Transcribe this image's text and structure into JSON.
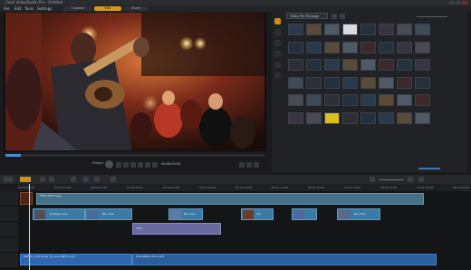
{
  "app": {
    "title": "Corel VideoStudio Pro - Untitled"
  },
  "menu": {
    "file": "File",
    "edit": "Edit",
    "tools": "Tools",
    "settings": "Settings"
  },
  "steps": {
    "capture": "Capture",
    "edit": "Edit",
    "share": "Share"
  },
  "library": {
    "folder": "Video Pro Package"
  },
  "player": {
    "mode_label": "Project",
    "timecode": "00:00:05:00"
  },
  "ruler_ticks": [
    "00:00:00:00",
    "00:00:10:00",
    "00:00:20:00",
    "00:00:30:00",
    "00:00:40:00",
    "00:00:50:00",
    "00:01:00:00",
    "00:01:10:00",
    "00:01:20:00",
    "00:01:30:00",
    "00:01:40:00",
    "00:01:50:00",
    "00:02:00:00"
  ],
  "timeline": {
    "overlay_clip": "FHD1T0077.jpg",
    "video_clip_1": "M_Bass1.wav",
    "video_clip_2": "BG_Intro",
    "video_clip_3": "BG_Intro",
    "video_clip_4": "clip",
    "video_clip_5": "BG_Intro",
    "title_clip": "Title",
    "music_clip_1": "CDF11_rock_timer_fix_sound#F1.mp3",
    "music_clip_2": "PhotoReflection.mp3"
  },
  "scrub_progress": 0.06,
  "colors": {
    "accent": "#d49a1a",
    "clip_blue": "#3a7aa4",
    "audio_blue": "#2f66b0"
  }
}
